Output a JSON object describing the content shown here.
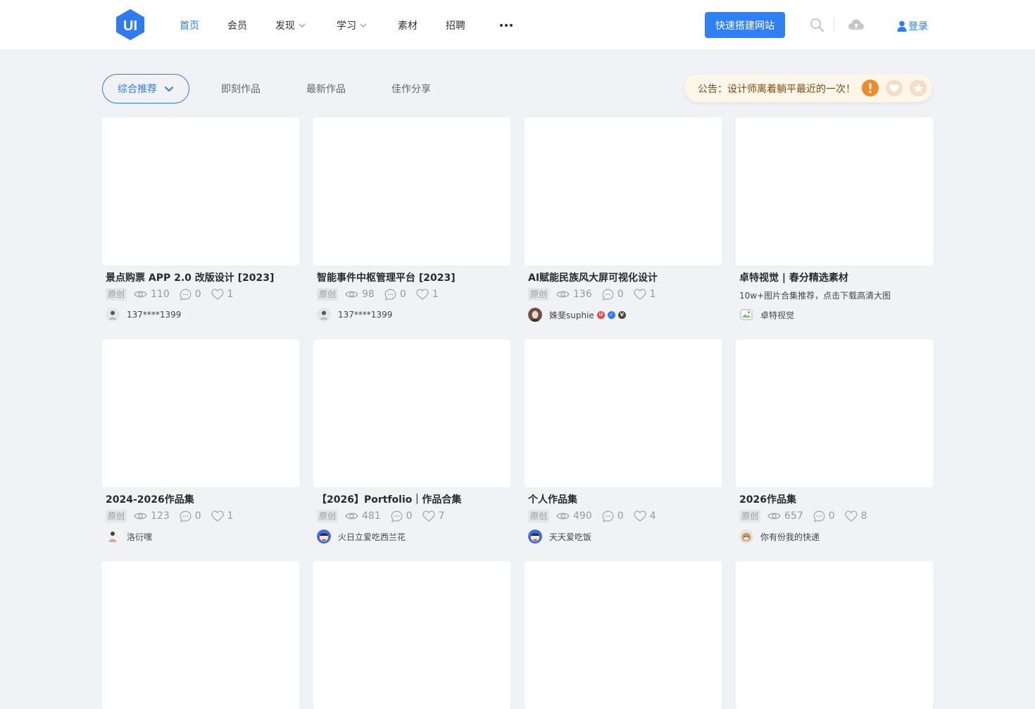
{
  "header": {
    "logo_text": "UI",
    "nav": [
      {
        "label": "首页",
        "active": true,
        "dropdown": false
      },
      {
        "label": "会员",
        "active": false,
        "dropdown": false
      },
      {
        "label": "发现",
        "active": false,
        "dropdown": true
      },
      {
        "label": "学习",
        "active": false,
        "dropdown": true
      },
      {
        "label": "素材",
        "active": false,
        "dropdown": false
      },
      {
        "label": "招聘",
        "active": false,
        "dropdown": false
      }
    ],
    "more_icon": "ellipsis-icon",
    "cta_label": "快速搭建网站",
    "search_icon": "search-icon",
    "upload_icon": "cloud-upload-icon",
    "login_label": "登录",
    "accent_color": "#2f7bf0"
  },
  "filter": {
    "active_label": "综合推荐",
    "tabs": [
      "即刻作品",
      "最新作品",
      "佳作分享"
    ]
  },
  "notice": {
    "text": "公告：设计师离着躺平最近的一次！",
    "icons": [
      "alert-icon",
      "heart-icon",
      "star-icon"
    ]
  },
  "cards": [
    {
      "title": "景点购票 APP 2.0 改版设计 [2023]",
      "tag": "原创",
      "views": "110",
      "comments": "0",
      "likes": "1",
      "author": "137****1399"
    },
    {
      "title": "智能事件中枢管理平台 [2023]",
      "tag": "原创",
      "views": "98",
      "comments": "0",
      "likes": "1",
      "author": "137****1399"
    },
    {
      "title": "AI赋能民族风大屏可视化设计",
      "tag": "原创",
      "views": "136",
      "comments": "0",
      "likes": "1",
      "author": "姝斐suphie",
      "badges": [
        "U",
        "✓",
        "V"
      ]
    },
    {
      "title": "卓特视觉 | 春分精选素材",
      "desc": "10w+图片合集推荐，点击下载高清大图",
      "author": "卓特视觉"
    },
    {
      "title": "2024-2026作品集",
      "tag": "原创",
      "views": "123",
      "comments": "0",
      "likes": "1",
      "author": "洛衍嘿"
    },
    {
      "title": "【2026】Portfolio｜作品合集",
      "tag": "原创",
      "views": "481",
      "comments": "0",
      "likes": "7",
      "author": "火日立爱吃西兰花"
    },
    {
      "title": "个人作品集",
      "tag": "原创",
      "views": "490",
      "comments": "0",
      "likes": "4",
      "author": "天天爱吃饭"
    },
    {
      "title": "2026作品集",
      "tag": "原创",
      "views": "657",
      "comments": "0",
      "likes": "8",
      "author": "你有份我的快递"
    },
    {
      "title": ""
    },
    {
      "title": ""
    },
    {
      "title": ""
    },
    {
      "title": ""
    }
  ]
}
